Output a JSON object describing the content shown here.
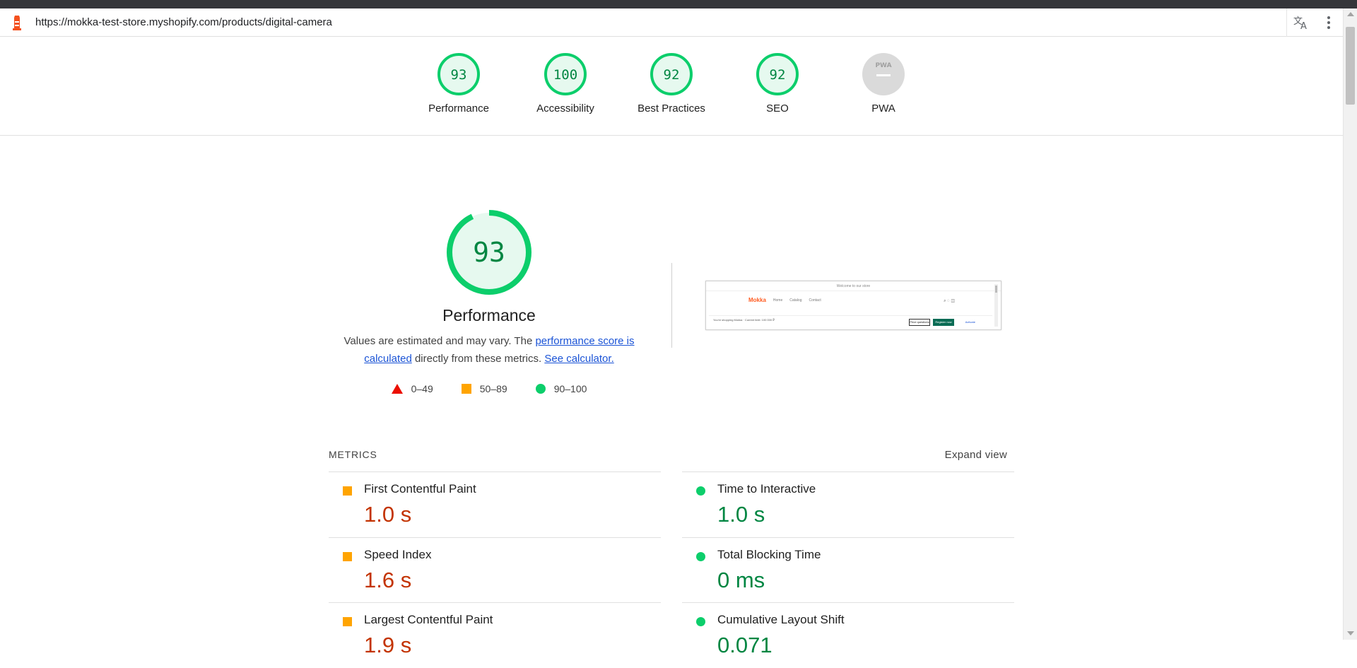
{
  "browser": {
    "url": "https://mokka-test-store.myshopify.com/products/digital-camera"
  },
  "summary": {
    "gauges": [
      {
        "label": "Performance",
        "score": "93",
        "color": "#0cce6b"
      },
      {
        "label": "Accessibility",
        "score": "100",
        "color": "#0cce6b"
      },
      {
        "label": "Best Practices",
        "score": "92",
        "color": "#0cce6b"
      },
      {
        "label": "SEO",
        "score": "92",
        "color": "#0cce6b"
      },
      {
        "label": "PWA",
        "score": "",
        "color": "#cccccc",
        "badge": "PWA"
      }
    ]
  },
  "performance": {
    "score": "93",
    "title": "Performance",
    "desc_part1": "Values are estimated and may vary. The ",
    "desc_link1": "performance score is calculated",
    "desc_part2": " directly from these metrics. ",
    "desc_link2": "See calculator.",
    "legend": [
      {
        "shape": "triangle",
        "label": "0–49",
        "color": "#eb0f00"
      },
      {
        "shape": "square",
        "label": "50–89",
        "color": "#ffa400"
      },
      {
        "shape": "circle",
        "label": "90–100",
        "color": "#0cce6b"
      }
    ]
  },
  "screenshot": {
    "top_text": "Welcome to our store",
    "logo": "Mokka",
    "nav": [
      "Home",
      "Catalog",
      "Contact"
    ],
    "bar_text": "You're shopping Mokka · Current limit: 100 000 ₽",
    "btn1": "Price questions",
    "btn2": "Register now",
    "btn3": "Activate"
  },
  "metrics": {
    "heading": "METRICS",
    "expand": "Expand view",
    "items": [
      {
        "name": "First Contentful Paint",
        "value": "1.0 s",
        "status": "orange"
      },
      {
        "name": "Time to Interactive",
        "value": "1.0 s",
        "status": "green"
      },
      {
        "name": "Speed Index",
        "value": "1.6 s",
        "status": "orange"
      },
      {
        "name": "Total Blocking Time",
        "value": "0 ms",
        "status": "green"
      },
      {
        "name": "Largest Contentful Paint",
        "value": "1.9 s",
        "status": "orange"
      },
      {
        "name": "Cumulative Layout Shift",
        "value": "0.071",
        "status": "green"
      }
    ]
  },
  "colors": {
    "pass": "#0cce6b",
    "average": "#ffa400",
    "fail": "#eb0f00"
  }
}
